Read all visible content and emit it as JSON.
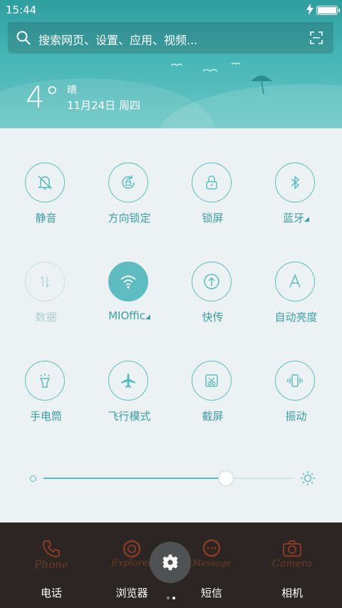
{
  "status_bar": {
    "time": "15:44"
  },
  "search": {
    "placeholder": "搜索网页、设置、应用、视频..."
  },
  "weather": {
    "temperature": "4°",
    "condition": "晴",
    "date": "11月24日 周四"
  },
  "toggles": [
    {
      "label": "静音",
      "icon": "bell-mute-icon",
      "state": "off"
    },
    {
      "label": "方向锁定",
      "icon": "rotation-lock-icon",
      "state": "off"
    },
    {
      "label": "锁屏",
      "icon": "lock-icon",
      "state": "off"
    },
    {
      "label": "蓝牙",
      "icon": "bluetooth-icon",
      "state": "off",
      "has_menu": true
    },
    {
      "label": "数据",
      "icon": "mobile-data-icon",
      "state": "disabled"
    },
    {
      "label": "MIOffic",
      "icon": "wifi-icon",
      "state": "on",
      "has_menu": true
    },
    {
      "label": "快传",
      "icon": "upload-share-icon",
      "state": "off"
    },
    {
      "label": "自动亮度",
      "icon": "auto-brightness-icon",
      "state": "off"
    },
    {
      "label": "手电筒",
      "icon": "flashlight-icon",
      "state": "off"
    },
    {
      "label": "飞行模式",
      "icon": "airplane-icon",
      "state": "off"
    },
    {
      "label": "截屏",
      "icon": "screenshot-icon",
      "state": "off"
    },
    {
      "label": "振动",
      "icon": "vibrate-icon",
      "state": "off"
    }
  ],
  "brightness": {
    "level": 0.73
  },
  "dock": [
    {
      "label": "电话",
      "doodle": "Phone"
    },
    {
      "label": "浏览器",
      "doodle": "Explorer"
    },
    {
      "label": "短信",
      "doodle": "Message"
    },
    {
      "label": "相机",
      "doodle": "Camera"
    }
  ],
  "colors": {
    "accent": "#5cbcc0",
    "header": "#47b6b6",
    "panel": "#ecf2f3"
  }
}
